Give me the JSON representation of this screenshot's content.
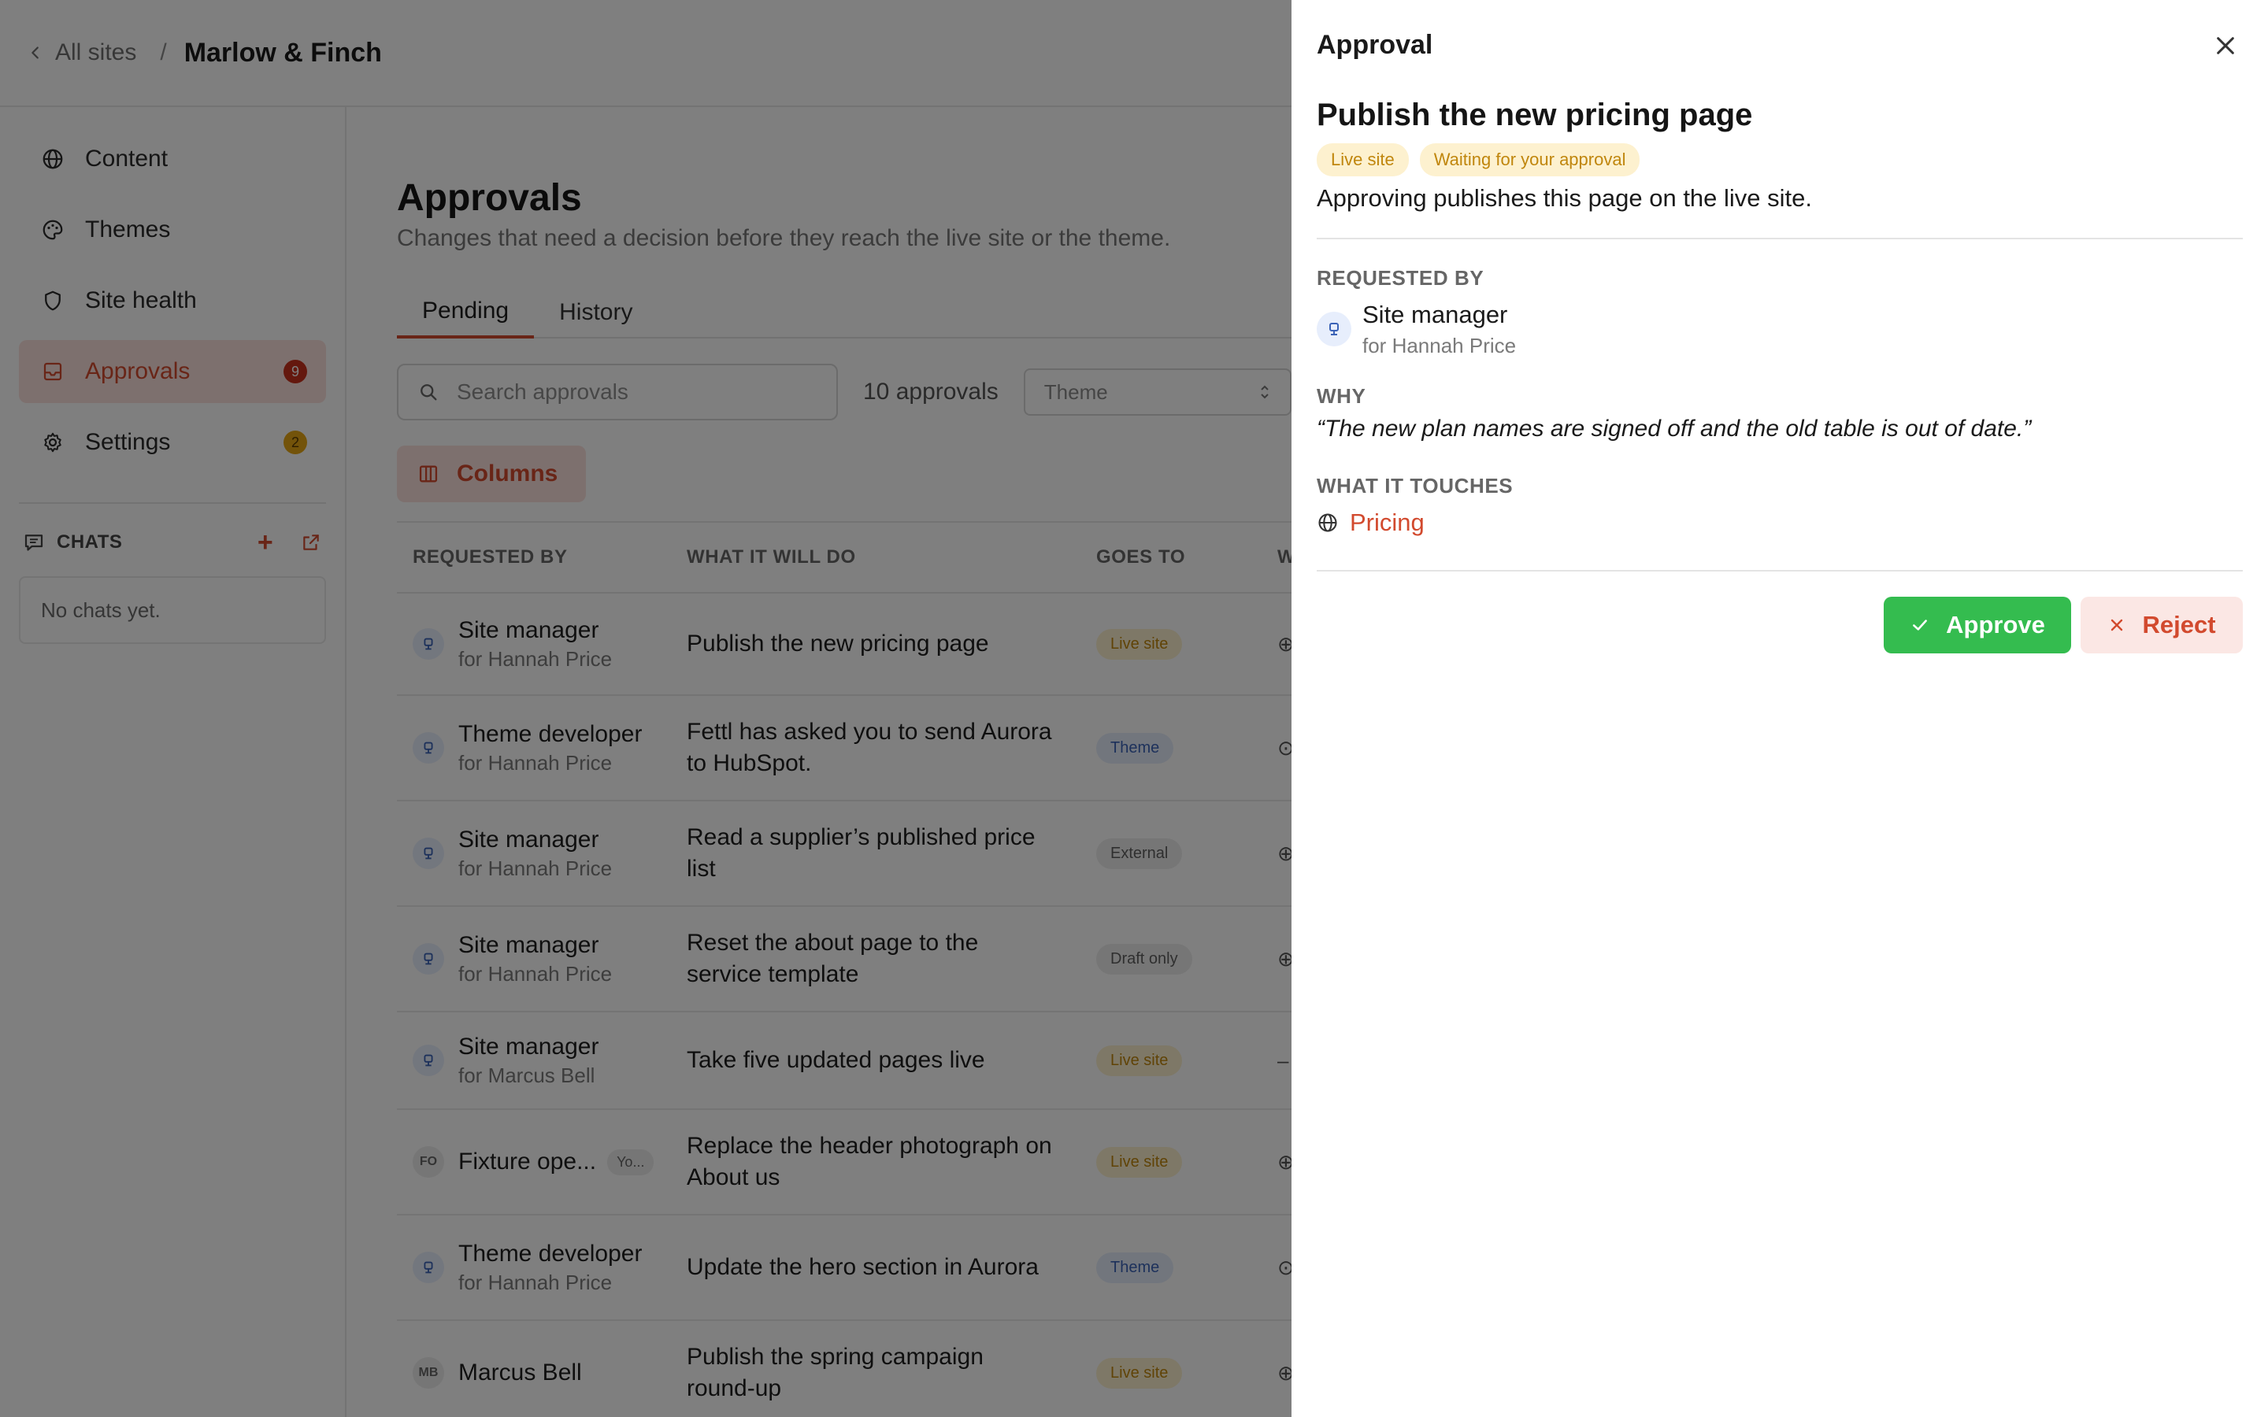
{
  "topbar": {
    "back_label": "All sites",
    "separator": "/",
    "site_name": "Marlow & Finch"
  },
  "sidebar": {
    "items": [
      {
        "label": "Content",
        "icon": "globe-icon"
      },
      {
        "label": "Themes",
        "icon": "palette-icon"
      },
      {
        "label": "Site health",
        "icon": "shield-icon"
      },
      {
        "label": "Approvals",
        "icon": "inbox-icon",
        "badge": "9",
        "active": true
      },
      {
        "label": "Settings",
        "icon": "gear-icon",
        "badge": "2"
      }
    ],
    "chats": {
      "heading": "CHATS",
      "add_symbol": "+",
      "empty_text": "No chats yet."
    }
  },
  "main": {
    "title": "Approvals",
    "subtitle": "Changes that need a decision before they reach the live site or the theme.",
    "tabs": [
      {
        "label": "Pending",
        "active": true
      },
      {
        "label": "History",
        "active": false
      }
    ],
    "search": {
      "placeholder": "Search approvals",
      "value": ""
    },
    "count": "10 approvals",
    "filter_select": "Theme",
    "columns_button": "Columns",
    "table": {
      "headers": [
        "REQUESTED BY",
        "WHAT IT WILL DO",
        "GOES TO",
        "W"
      ],
      "rows": [
        {
          "name": "Site manager",
          "for": "for Hannah Price",
          "action": "Publish the new pricing page",
          "goes_to": "Live site",
          "goes_to_kind": "live",
          "avatar": "robot",
          "glyph": "⊕"
        },
        {
          "name": "Theme developer",
          "for": "for Hannah Price",
          "action": "Fettl has asked you to send Aurora to HubSpot.",
          "goes_to": "Theme",
          "goes_to_kind": "theme",
          "avatar": "robot",
          "glyph": "⊙"
        },
        {
          "name": "Site manager",
          "for": "for Hannah Price",
          "action": "Read a supplier’s published price list",
          "goes_to": "External",
          "goes_to_kind": "ext",
          "avatar": "robot",
          "glyph": "⊕"
        },
        {
          "name": "Site manager",
          "for": "for Hannah Price",
          "action": "Reset the about page to the service template",
          "goes_to": "Draft only",
          "goes_to_kind": "draft",
          "avatar": "robot",
          "glyph": "⊕"
        },
        {
          "name": "Site manager",
          "for": "for Marcus Bell",
          "action": "Take five updated pages live",
          "goes_to": "Live site",
          "goes_to_kind": "live",
          "avatar": "robot",
          "glyph": "–"
        },
        {
          "name": "Fixture ope...",
          "for": "",
          "you": "Yo...",
          "action": "Replace the header photograph on About us",
          "goes_to": "Live site",
          "goes_to_kind": "live",
          "avatar": "FO",
          "glyph": "⊕"
        },
        {
          "name": "Theme developer",
          "for": "for Hannah Price",
          "action": "Update the hero section in Aurora",
          "goes_to": "Theme",
          "goes_to_kind": "theme",
          "avatar": "robot",
          "glyph": "⊙"
        },
        {
          "name": "Marcus Bell",
          "for": "",
          "action": "Publish the spring campaign round-up",
          "goes_to": "Live site",
          "goes_to_kind": "live",
          "avatar": "MB",
          "glyph": "⊕"
        }
      ]
    }
  },
  "panel": {
    "heading": "Approval",
    "title": "Publish the new pricing page",
    "tags": [
      "Live site",
      "Waiting for your approval"
    ],
    "description": "Approving publishes this page on the live site.",
    "requested_by_label": "REQUESTED BY",
    "requester_name": "Site manager",
    "requester_for": "for Hannah Price",
    "why_label": "WHY",
    "why_text": "“The new plan names are signed off and the old table is out of date.”",
    "touches_label": "WHAT IT TOUCHES",
    "touches_item": "Pricing",
    "approve_label": "Approve",
    "reject_label": "Reject"
  },
  "colors": {
    "accent": "#d24a2e",
    "approve": "#34bc4f",
    "live_tag": "#c0860d",
    "theme_tag": "#3b63b7"
  }
}
